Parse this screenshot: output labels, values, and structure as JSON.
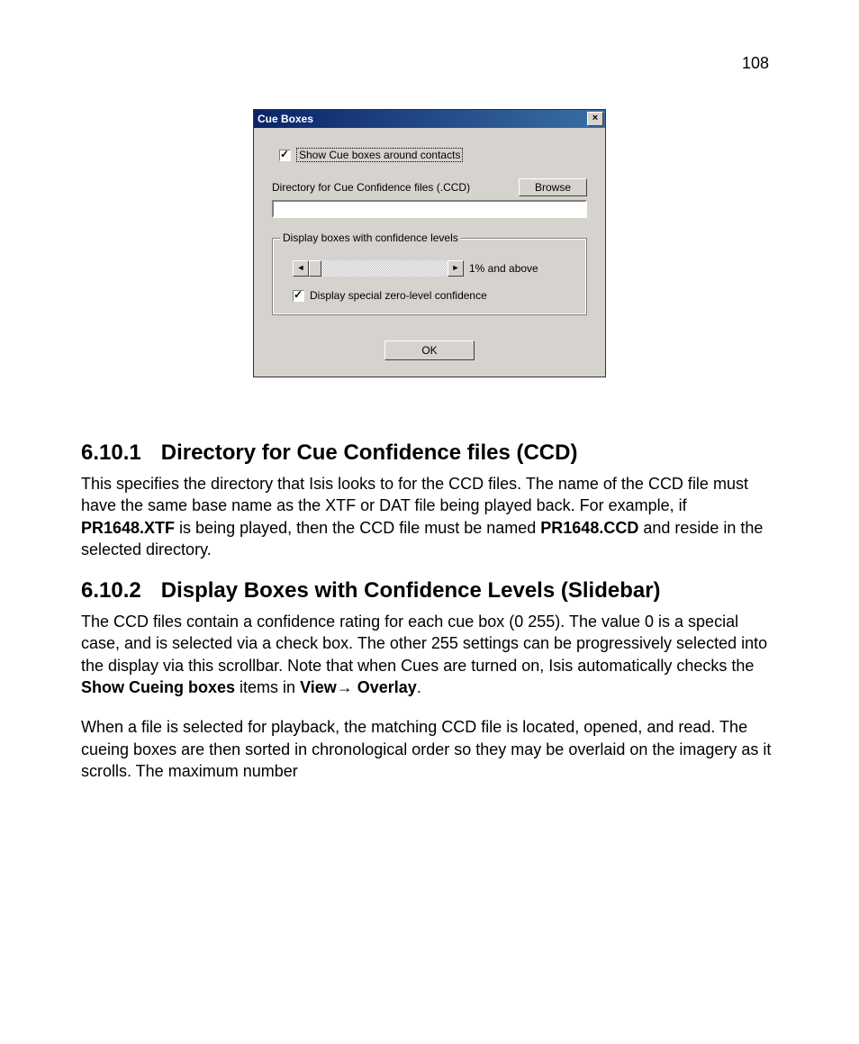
{
  "page_number": "108",
  "dialog": {
    "title": "Cue Boxes",
    "close_glyph": "×",
    "show_cue_label": "Show Cue boxes around contacts",
    "show_cue_checked": true,
    "dir_label": "Directory for Cue Confidence files (.CCD)",
    "browse_label": "Browse",
    "dir_value": "",
    "group_legend": "Display boxes with confidence levels",
    "slider_left_glyph": "◄",
    "slider_right_glyph": "►",
    "slider_value_label": "1% and above",
    "zero_level_label": "Display special zero-level confidence",
    "zero_level_checked": true,
    "ok_label": "OK"
  },
  "sections": {
    "s1_num": "6.10.1",
    "s1_title": "Directory for Cue Confidence files (CCD)",
    "s1_p1a": "This specifies the directory that Isis looks to for the CCD files. The name of the CCD file must have the same base name as the XTF or DAT file being played back. For example, if ",
    "s1_b1": "PR1648.XTF",
    "s1_p1b": " is being played, then the CCD file must be named ",
    "s1_b2": "PR1648.CCD",
    "s1_p1c": " and reside in the selected directory.",
    "s2_num": "6.10.2",
    "s2_title": "Display Boxes with Confidence Levels (Slidebar)",
    "s2_p1a": "The CCD files contain a confidence rating for each cue box (0 255). The value 0 is a special case, and is selected via a check box. The other 255 settings can be progressively selected into the display via this scrollbar. Note that when Cues are turned on, Isis automatically checks the ",
    "s2_b1": "Show Cueing boxes",
    "s2_p1b": " items in ",
    "s2_b2": "View→ Overlay",
    "s2_p1c": ".",
    "s2_p2": "When a file is selected for playback, the matching CCD file is located, opened, and read. The cueing boxes are then sorted in chronological order so they may be overlaid on the imagery as it scrolls. The maximum number"
  }
}
